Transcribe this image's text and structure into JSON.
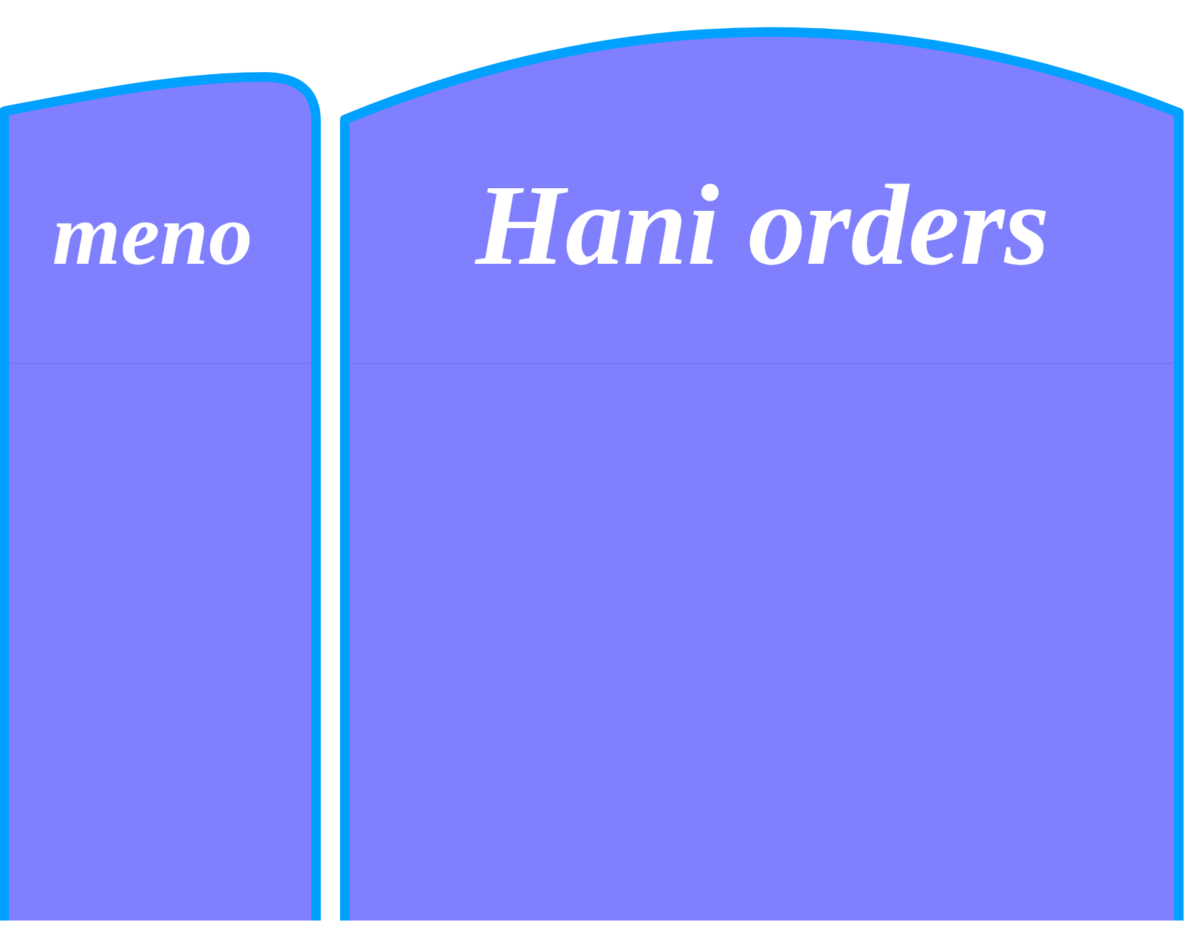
{
  "left_panel": {
    "title": "meno"
  },
  "right_panel": {
    "title": "Hani orders"
  }
}
